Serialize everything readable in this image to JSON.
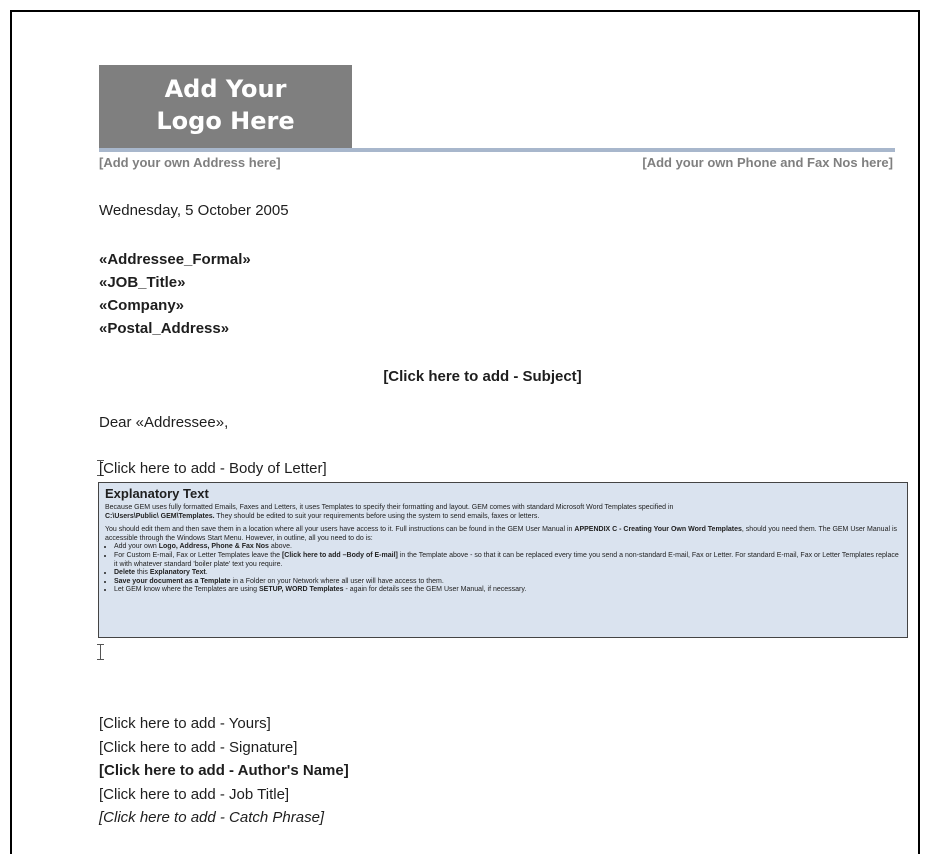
{
  "logo": {
    "line1": "Add Your",
    "line2": "Logo Here"
  },
  "header": {
    "address": "[Add your own Address here]",
    "phone": "[Add your own Phone and Fax Nos here]"
  },
  "letter": {
    "date": "Wednesday, 5 October 2005",
    "addressee_formal": "«Addressee_Formal»",
    "job_title": "«JOB_Title»",
    "company": "«Company»",
    "postal_address": "«Postal_Address»",
    "subject": "[Click here to add - Subject]",
    "salutation": "Dear «Addressee»,",
    "body": "[Click here to add - Body of Letter]"
  },
  "explanatory": {
    "heading": "Explanatory Text",
    "para1": "Because GEM uses fully formatted Emails, Faxes and Letters, it uses Templates to specify their formatting and layout.  GEM comes with standard Microsoft Word Templates specified in",
    "para1_path": "C:\\Users\\Public\\ GEM\\Templates.",
    "para1_tail": "  They should be edited to suit your requirements before using the system to send emails, faxes or letters.",
    "para2a": "You should edit them and then save them in a location  where all your users have access to it.  Full instructions  can be found in the GEM User Manual in ",
    "para2_appendix": "APPENDIX C - Creating Your Own Word Templates",
    "para2b": ", should you need them.  The GEM User Manual is accessible through the Windows Start Menu.   However, in outline,  all you need to do is:",
    "b1a": "Add your own ",
    "b1b": "Logo, Address, Phone  & Fax Nos",
    "b1c": " above.",
    "b2a": "For Custom E-mail, Fax or Letter Templates leave the ",
    "b2b": "[Click here to add –Body of E-mail]",
    "b2c": " in the Template above - so that it can be replaced every time you send a non-standard E-mail, Fax or Letter.  For standard E-mail, Fax or Letter Templates replace it with  whatever standard 'boiler plate' text  you require.",
    "b3a": "Delete",
    "b3b": " this ",
    "b3c": "Explanatory Text",
    "b3d": ".",
    "b4a": "Save your document  as a Template",
    "b4b": " in a Folder on your Network  where all user will have access to them.",
    "b5a": "Let GEM know where the Templates are using ",
    "b5b": "SETUP, WORD Templates",
    "b5c": " - again for details see the GEM User Manual, if necessary."
  },
  "closing": {
    "yours": "[Click here to add - Yours]",
    "signature": "[Click here to add - Signature]",
    "author": "[Click here to add - Author's Name]",
    "job_title": "[Click here to add - Job Title]",
    "catch_phrase": "[Click here to add - Catch Phrase]"
  }
}
